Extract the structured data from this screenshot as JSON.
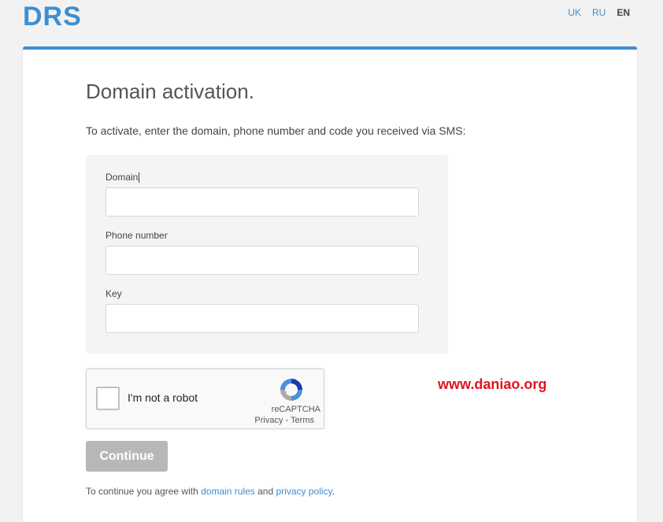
{
  "header": {
    "logo": "DRS",
    "languages": [
      {
        "label": "UK",
        "active": false
      },
      {
        "label": "RU",
        "active": false
      },
      {
        "label": "EN",
        "active": true
      }
    ]
  },
  "page": {
    "title": "Domain activation.",
    "subtitle": "To activate, enter the domain, phone number and code you received via SMS:"
  },
  "form": {
    "domain_label": "Domain",
    "domain_value": "",
    "phone_label": "Phone number",
    "phone_value": "",
    "key_label": "Key",
    "key_value": ""
  },
  "captcha": {
    "label": "I'm not a robot",
    "brand": "reCAPTCHA",
    "privacy": "Privacy",
    "separator": " - ",
    "terms": "Terms"
  },
  "watermark": "www.daniao.org",
  "actions": {
    "continue_label": "Continue"
  },
  "agreement": {
    "prefix": "To continue you agree with ",
    "rules_link": "domain rules",
    "middle": " and ",
    "privacy_link": "privacy policy",
    "suffix": "."
  },
  "colors": {
    "accent": "#3d8fd1",
    "button_disabled": "#b7b7b7",
    "watermark": "#e0141e"
  }
}
